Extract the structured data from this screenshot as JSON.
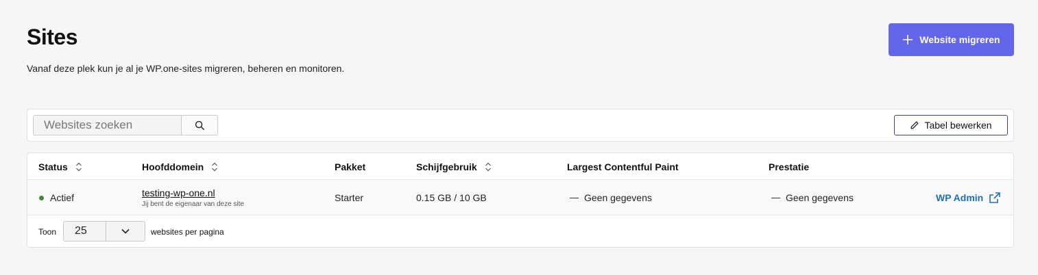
{
  "header": {
    "title": "Sites",
    "subtitle": "Vanaf deze plek kun je al je WP.one-sites migreren, beheren en monitoren.",
    "migrate_button_label": "Website migreren",
    "migrate_button_icon": "plus-icon",
    "accent_color": "#6466e9"
  },
  "toolbar": {
    "search_placeholder": "Websites zoeken",
    "search_value": "",
    "search_icon": "search-icon",
    "edit_table_label": "Tabel bewerken",
    "edit_table_icon": "pencil-icon"
  },
  "table": {
    "columns": [
      {
        "label": "Status",
        "sortable": true
      },
      {
        "label": "Hoofddomein",
        "sortable": true
      },
      {
        "label": "Pakket",
        "sortable": false
      },
      {
        "label": "Schijfgebruik",
        "sortable": true
      },
      {
        "label": "Largest Contentful Paint",
        "sortable": false
      },
      {
        "label": "Prestatie",
        "sortable": false
      }
    ],
    "rows": [
      {
        "status": "Actief",
        "status_color": "#3c8d2f",
        "domain": "testing-wp-one.nl",
        "domain_note": "Jij bent de eigenaar van deze site",
        "package": "Starter",
        "disk_usage": "0.15 GB / 10 GB",
        "lcp": "Geen gegevens",
        "performance": "Geen gegevens",
        "action_label": "WP Admin",
        "action_icon": "external-link-icon",
        "action_color": "#1f6fb7"
      }
    ]
  },
  "pagination": {
    "prefix": "Toon",
    "per_page_value": "25",
    "suffix": "websites per pagina",
    "dropdown_icon": "chevron-down-icon"
  }
}
